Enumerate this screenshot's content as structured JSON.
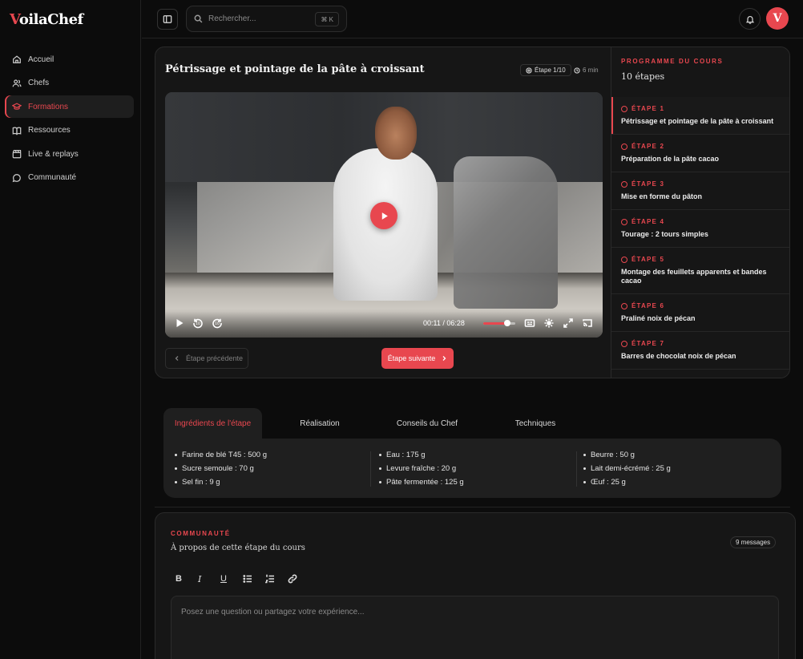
{
  "brand": {
    "logo_v": "V",
    "logo_rest": "oilaChef",
    "accent": "#e8474f"
  },
  "sidebar": {
    "items": [
      {
        "label": "Accueil",
        "icon": "home-icon"
      },
      {
        "label": "Chefs",
        "icon": "users-icon"
      },
      {
        "label": "Formations",
        "icon": "graduation-cap-icon",
        "active": true
      },
      {
        "label": "Ressources",
        "icon": "book-icon"
      },
      {
        "label": "Live & replays",
        "icon": "clapperboard-icon"
      },
      {
        "label": "Communauté",
        "icon": "chat-bubble-icon"
      }
    ]
  },
  "topbar": {
    "search_placeholder": "Rechercher...",
    "shortcut": "⌘ K",
    "avatar_letter": "V"
  },
  "lesson": {
    "title": "Pétrissage et pointage de la pâte à croissant",
    "step_badge": "Étape 1/10",
    "duration": "6 min"
  },
  "video": {
    "time_current": "00:11",
    "time_separator": "/",
    "time_total": "06:28",
    "volume": 0.75
  },
  "nav_buttons": {
    "prev": "Étape précédente",
    "next": "Étape suivante"
  },
  "program": {
    "eyebrow": "PROGRAMME DU COURS",
    "count": "10 étapes",
    "steps": [
      {
        "label": "ÉTAPE 1",
        "title": "Pétrissage et pointage de la pâte à croissant",
        "active": true
      },
      {
        "label": "ÉTAPE 2",
        "title": "Préparation de la pâte cacao"
      },
      {
        "label": "ÉTAPE 3",
        "title": "Mise en forme du pâton"
      },
      {
        "label": "ÉTAPE 4",
        "title": "Tourage : 2 tours simples"
      },
      {
        "label": "ÉTAPE 5",
        "title": "Montage des feuillets apparents et bandes cacao"
      },
      {
        "label": "ÉTAPE 6",
        "title": "Praliné noix de pécan"
      },
      {
        "label": "ÉTAPE 7",
        "title": "Barres de chocolat noix de pécan"
      }
    ]
  },
  "tabs": [
    {
      "label": "Ingrédients de l'étape",
      "active": true
    },
    {
      "label": "Réalisation"
    },
    {
      "label": "Conseils du Chef"
    },
    {
      "label": "Techniques"
    }
  ],
  "ingredients": {
    "col1": [
      "Farine de blé T45 : 500 g",
      "Sucre semoule : 70 g",
      "Sel fin : 9 g"
    ],
    "col2": [
      "Eau : 175 g",
      "Levure fraîche : 20 g",
      "Pâte fermentée : 125 g"
    ],
    "col3": [
      "Beurre : 50 g",
      "Lait demi-écrémé : 25 g",
      "Œuf : 25 g"
    ]
  },
  "community": {
    "eyebrow": "COMMUNAUTÉ",
    "subtitle": "À propos de cette étape du cours",
    "messages": "9 messages",
    "toolbar": [
      "B",
      "I",
      "U"
    ],
    "placeholder": "Posez une question ou partagez votre expérience..."
  }
}
